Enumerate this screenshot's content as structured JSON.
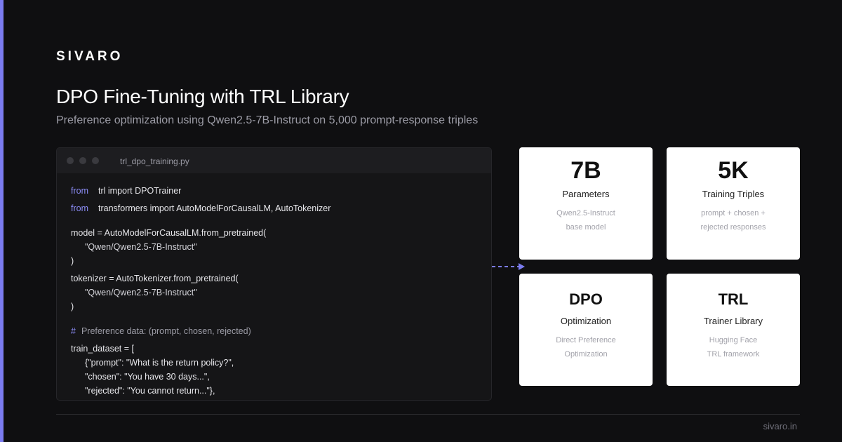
{
  "brand": "SIVARO",
  "title": "DPO Fine-Tuning with TRL Library",
  "subtitle": "Preference optimization using Qwen2.5-7B-Instruct on 5,000 prompt-response triples",
  "editor": {
    "filename": "trl_dpo_training.py",
    "lines": {
      "l1_kw": "from",
      "l1_rest": "trl import DPOTrainer",
      "l2_kw": "from",
      "l2_rest": "transformers import AutoModelForCausalLM, AutoTokenizer",
      "l3": "model = AutoModelForCausalLM.from_pretrained(",
      "l4": "\"Qwen/Qwen2.5-7B-Instruct\"",
      "l5": ")",
      "l6": "tokenizer = AutoTokenizer.from_pretrained(",
      "l7": "\"Qwen/Qwen2.5-7B-Instruct\"",
      "l8": ")",
      "l9_hash": "#",
      "l9_rest": "Preference data: (prompt, chosen, rejected)",
      "l10": "train_dataset = [",
      "l11": "{\"prompt\": \"What is the return policy?\",",
      "l12": "\"chosen\": \"You have 30 days...\",",
      "l13": "\"rejected\": \"You cannot return...\"},"
    }
  },
  "cards": [
    {
      "big": "7B",
      "label": "Parameters",
      "desc1": "Qwen2.5-Instruct",
      "desc2": "base model"
    },
    {
      "big": "5K",
      "label": "Training Triples",
      "desc1": "prompt + chosen +",
      "desc2": "rejected responses"
    },
    {
      "big": "DPO",
      "label": "Optimization",
      "desc1": "Direct Preference",
      "desc2": "Optimization"
    },
    {
      "big": "TRL",
      "label": "Trainer Library",
      "desc1": "Hugging Face",
      "desc2": "TRL framework"
    }
  ],
  "footer": {
    "url": "sivaro.in"
  },
  "colors": {
    "accent": "#7b7cf0",
    "background": "#0f0f11",
    "card": "#ffffff"
  }
}
